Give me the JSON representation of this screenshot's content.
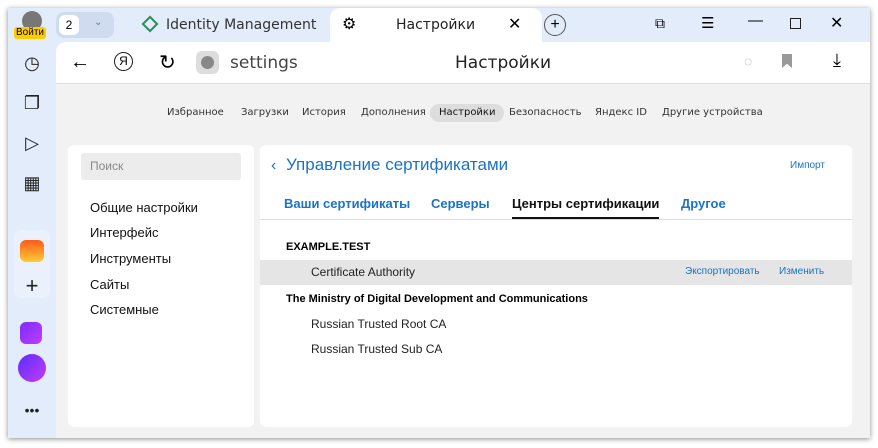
{
  "profile": {
    "login_label": "Войти"
  },
  "tabs": {
    "count": "2",
    "items": [
      {
        "title": "Identity Management"
      },
      {
        "title": "Настройки"
      }
    ]
  },
  "toolbar": {
    "address": "settings",
    "page_title": "Настройки"
  },
  "nav": [
    "Избранное",
    "Загрузки",
    "История",
    "Дополнения",
    "Настройки",
    "Безопасность",
    "Яндекс ID",
    "Другие устройства"
  ],
  "sidebar": {
    "search_placeholder": "Поиск",
    "items": [
      "Общие настройки",
      "Интерфейс",
      "Инструменты",
      "Сайты",
      "Системные"
    ]
  },
  "certs": {
    "title": "Управление сертификатами",
    "import_label": "Импорт",
    "tabs": [
      "Ваши сертификаты",
      "Серверы",
      "Центры сертификации",
      "Другое"
    ],
    "active_tab": "Центры сертификации",
    "groups": [
      {
        "name": "EXAMPLE.TEST",
        "items": [
          "Certificate Authority"
        ]
      },
      {
        "name": "The Ministry of Digital Development and Communications",
        "items": [
          "Russian Trusted Root CA",
          "Russian Trusted Sub CA"
        ]
      }
    ],
    "export_label": "Экспортировать",
    "edit_label": "Изменить"
  }
}
